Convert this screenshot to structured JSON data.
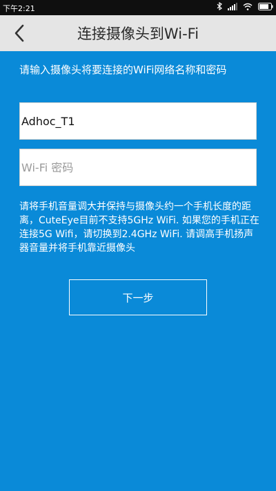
{
  "status_bar": {
    "time": "下午2:21",
    "icons": [
      "bluetooth-icon",
      "signal-icon",
      "wifi-icon",
      "battery-icon"
    ]
  },
  "header": {
    "title": "连接摄像头到Wi-Fi",
    "back_icon": "chevron-left-icon"
  },
  "main": {
    "instruction": "请输入摄像头将要连接的WiFi网络名称和密码",
    "ssid": {
      "value": "Adhoc_T1"
    },
    "password": {
      "value": "",
      "placeholder": "Wi-Fi 密码"
    },
    "hint": "请将手机音量调大并保持与摄像头约一个手机长度的距离，CuteEye目前不支持5GHz WiFi. 如果您的手机正在连接5G Wifi，请切换到2.4GHz WiFi. 请调高手机扬声器音量并将手机靠近摄像头",
    "next_button_label": "下一步"
  },
  "colors": {
    "background": "#0a8ad8",
    "title_bar": "#e5e5e5",
    "status_bar": "#0f0f0f"
  }
}
